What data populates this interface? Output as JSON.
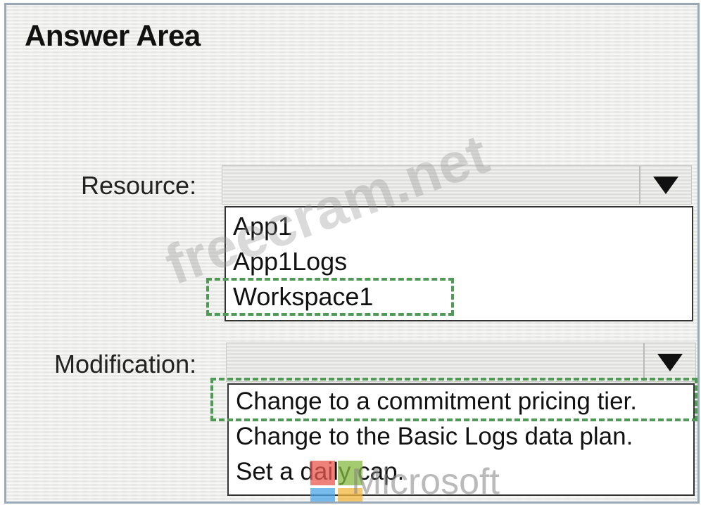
{
  "title": "Answer Area",
  "resource": {
    "label": "Resource:",
    "options": [
      "App1",
      "App1Logs",
      "Workspace1"
    ],
    "selected_answer": "Workspace1"
  },
  "modification": {
    "label": "Modification:",
    "options": [
      "Change to a commitment pricing tier.",
      "Change to the Basic Logs data plan.",
      "Set a daily cap."
    ],
    "selected_answer": "Change to a commitment pricing tier."
  },
  "watermark": "freecram.net",
  "logo_text": "Microsoft",
  "colors": {
    "answer_highlight": "#4f9b55",
    "frame_border": "#9aa8b8",
    "logo_red": "#e8574d",
    "logo_green": "#86b93f",
    "logo_blue": "#4aa6e6",
    "logo_yellow": "#f2b53d"
  },
  "icons": [
    "dropdown-arrow-icon",
    "microsoft-logo-icon"
  ]
}
